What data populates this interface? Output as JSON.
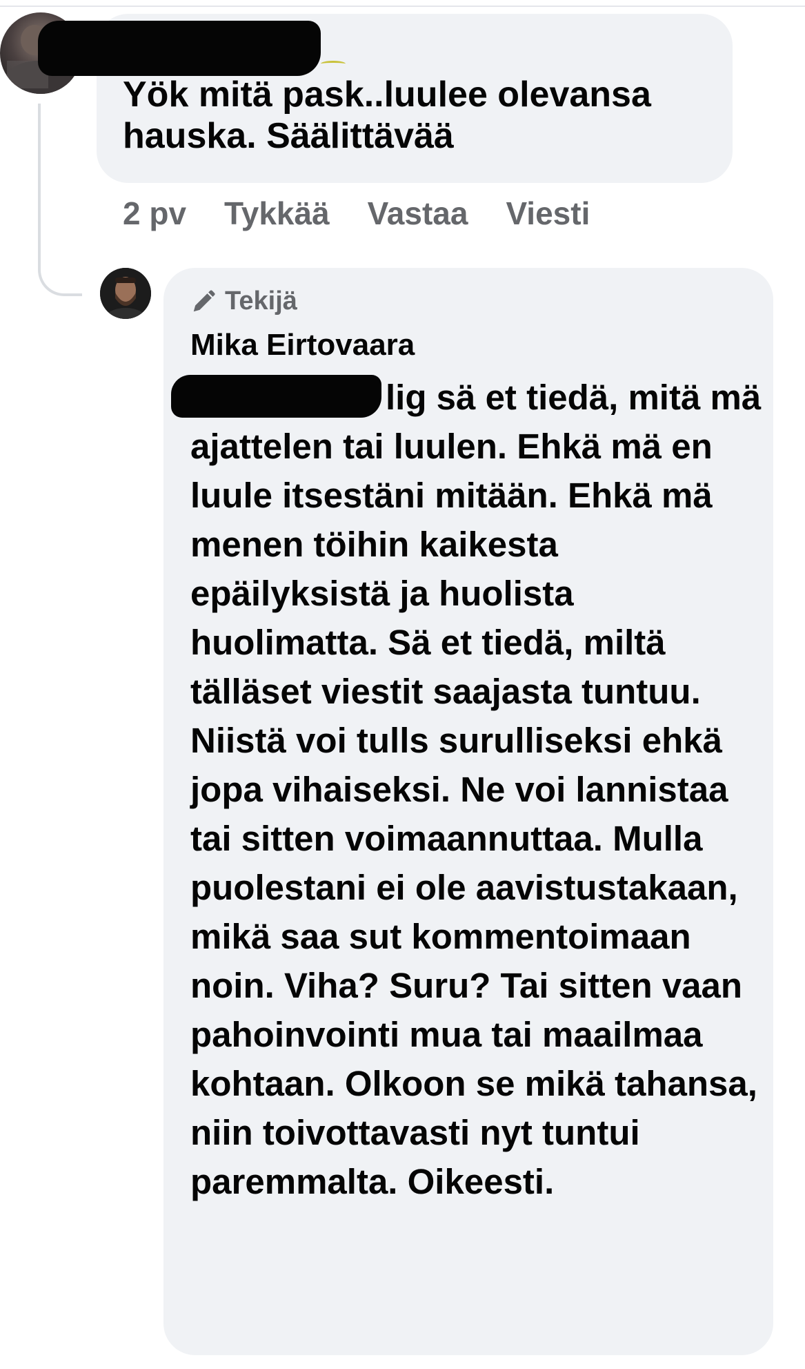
{
  "comment_1": {
    "text": "Yök mitä pask..luulee olevansa\nhauska. Säälittävää",
    "actions": {
      "time": "2 pv",
      "like": "Tykkää",
      "reply": "Vastaa",
      "message": "Viesti"
    }
  },
  "reply_1": {
    "badge": "Tekijä",
    "author": "Mika Eirtovaara",
    "mention_tail": "lig",
    "body": " sä et tiedä, mitä mä ajattelen tai luulen. Ehkä mä en  luule itsestäni mitään. Ehkä mä menen töihin kaikesta epäilyksistä ja huolista huolimatta. Sä et tiedä, miltä tälläset viestit saajasta tuntuu. Niistä voi tulls surulliseksi ehkä jopa vihaiseksi. Ne voi lannistaa tai sitten voimaannuttaa. Mulla puolestani ei ole aavistustakaan, mikä saa sut kommentoimaan noin. Viha? Suru? Tai sitten vaan pahoinvointi mua tai maailmaa kohtaan. Olkoon se mikä tahansa, niin toivottavasti nyt tuntui paremmalta. Oikeesti."
  },
  "colors": {
    "bubble": "#f0f2f5",
    "meta_text": "#65676b",
    "body_text": "#050505",
    "thread_line": "#dadde1"
  }
}
